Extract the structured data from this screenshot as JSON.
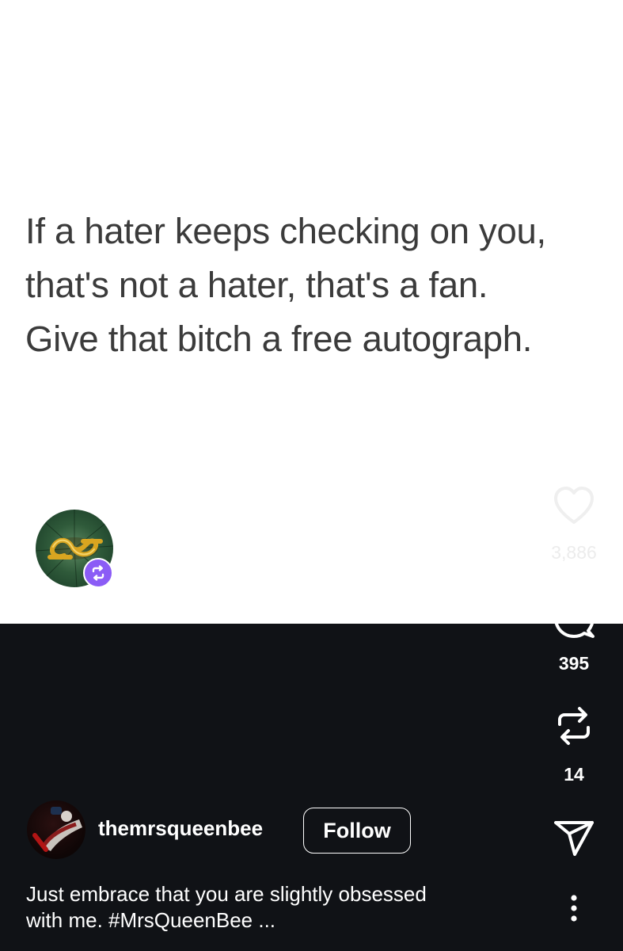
{
  "post": {
    "image_text_lines": [
      "If a hater keeps checking on you,",
      "that's not a hater, that's a fan.",
      "Give that bitch a free autograph."
    ]
  },
  "actions": {
    "like_count": "3,886",
    "comment_count": "395",
    "repost_count": "14"
  },
  "author": {
    "username": "themrsqueenbee",
    "follow_label": "Follow"
  },
  "caption": {
    "lines": [
      "Just embrace that you are slightly obsessed",
      "with me. #MrsQueenBee ..."
    ]
  },
  "icons": {
    "like": "heart-icon",
    "comment": "comment-bubble-icon",
    "repost": "repost-icon",
    "share": "paper-plane-icon",
    "more": "more-vertical-icon",
    "repost_badge": "repost-badge-icon"
  },
  "colors": {
    "dark_background": "#101216",
    "repost_badge": "#8b5cf6",
    "image_text": "#3b3b3b"
  }
}
